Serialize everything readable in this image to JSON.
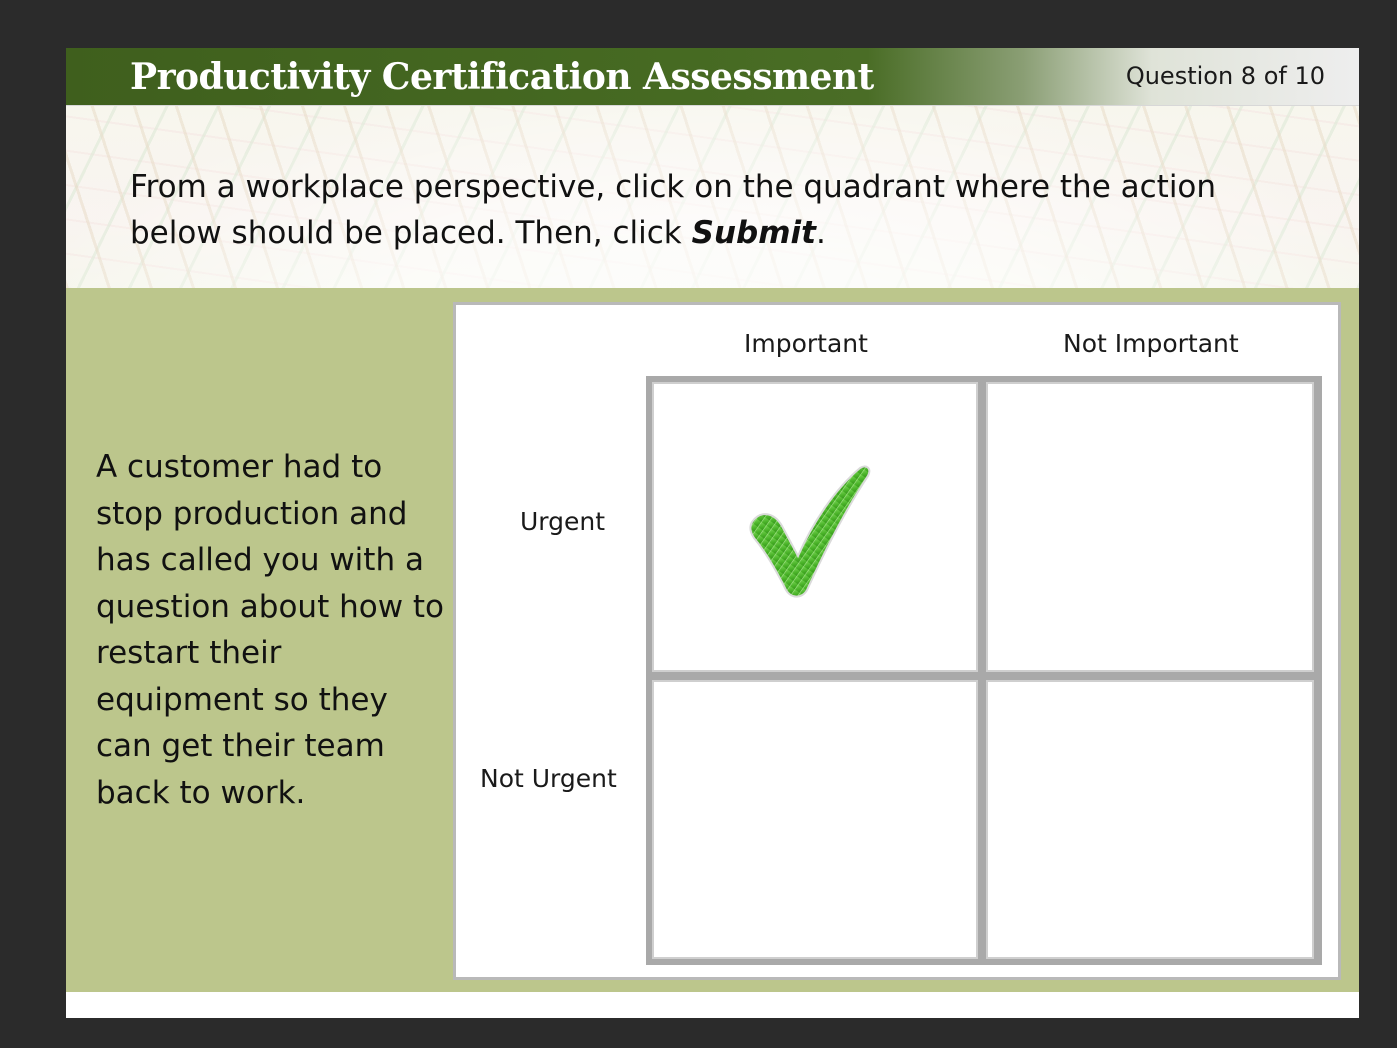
{
  "header": {
    "title": "Productivity Certification Assessment",
    "question_counter": "Question 8 of 10"
  },
  "instructions": {
    "text_before": "From a workplace perspective, click on the quadrant where the action below should be placed. Then, click ",
    "emphasis": "Submit",
    "text_after": "."
  },
  "scenario": {
    "text": "A customer had to stop production and has called you with a question about how to restart their equipment so they can get their team back to work."
  },
  "matrix": {
    "columns": [
      "Important",
      "Not Important"
    ],
    "rows": [
      "Urgent",
      "Not Urgent"
    ],
    "selected_quadrant": "Urgent / Important",
    "selection_icon": "checkmark-icon"
  },
  "colors": {
    "header_green": "#466a22",
    "panel_green": "#bcc68c",
    "check_green": "#3fae1c",
    "background": "#2b2b2b"
  }
}
